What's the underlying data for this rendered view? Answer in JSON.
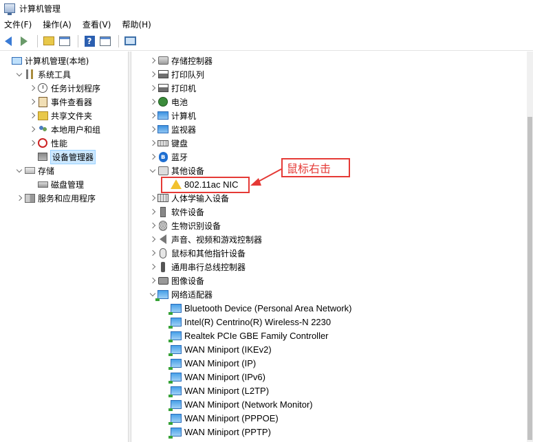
{
  "window": {
    "title": "计算机管理"
  },
  "menu": [
    "文件(F)",
    "操作(A)",
    "查看(V)",
    "帮助(H)"
  ],
  "toolbar": {
    "help_glyph": "?",
    "icons": [
      "back-icon",
      "forward-icon",
      "up-folder-icon",
      "show-hide-tree-icon",
      "help-icon",
      "properties-icon",
      "monitor-icon"
    ]
  },
  "left_tree": [
    {
      "label": "计算机管理(本地)",
      "icon": "computer-management-icon",
      "level": 0,
      "state": "none"
    },
    {
      "label": "系统工具",
      "icon": "system-tools-icon",
      "level": 1,
      "state": "expanded"
    },
    {
      "label": "任务计划程序",
      "icon": "task-scheduler-icon",
      "level": 2,
      "state": "collapsed"
    },
    {
      "label": "事件查看器",
      "icon": "event-viewer-icon",
      "level": 2,
      "state": "collapsed"
    },
    {
      "label": "共享文件夹",
      "icon": "shared-folders-icon",
      "level": 2,
      "state": "collapsed"
    },
    {
      "label": "本地用户和组",
      "icon": "local-users-icon",
      "level": 2,
      "state": "collapsed"
    },
    {
      "label": "性能",
      "icon": "performance-icon",
      "level": 2,
      "state": "collapsed"
    },
    {
      "label": "设备管理器",
      "icon": "device-manager-icon",
      "level": 2,
      "state": "none",
      "selected": true
    },
    {
      "label": "存储",
      "icon": "storage-icon",
      "level": 1,
      "state": "expanded"
    },
    {
      "label": "磁盘管理",
      "icon": "disk-management-icon",
      "level": 2,
      "state": "none"
    },
    {
      "label": "服务和应用程序",
      "icon": "services-apps-icon",
      "level": 1,
      "state": "collapsed"
    }
  ],
  "device_tree": [
    {
      "label": "存储控制器",
      "icon": "storage-controller-icon",
      "level": 0,
      "state": "collapsed"
    },
    {
      "label": "打印队列",
      "icon": "print-queue-icon",
      "level": 0,
      "state": "collapsed"
    },
    {
      "label": "打印机",
      "icon": "printer-icon",
      "level": 0,
      "state": "collapsed"
    },
    {
      "label": "电池",
      "icon": "battery-icon",
      "level": 0,
      "state": "collapsed"
    },
    {
      "label": "计算机",
      "icon": "computer-icon",
      "level": 0,
      "state": "collapsed"
    },
    {
      "label": "监视器",
      "icon": "monitor-icon",
      "level": 0,
      "state": "collapsed"
    },
    {
      "label": "键盘",
      "icon": "keyboard-icon",
      "level": 0,
      "state": "collapsed"
    },
    {
      "label": "蓝牙",
      "icon": "bluetooth-icon",
      "level": 0,
      "state": "collapsed"
    },
    {
      "label": "其他设备",
      "icon": "other-devices-icon",
      "level": 0,
      "state": "expanded"
    },
    {
      "label": "802.11ac NIC",
      "icon": "warning-device-icon",
      "level": 1,
      "state": "none"
    },
    {
      "label": "人体学输入设备",
      "icon": "hid-icon",
      "level": 0,
      "state": "collapsed"
    },
    {
      "label": "软件设备",
      "icon": "software-device-icon",
      "level": 0,
      "state": "collapsed"
    },
    {
      "label": "生物识别设备",
      "icon": "biometric-icon",
      "level": 0,
      "state": "collapsed"
    },
    {
      "label": "声音、视频和游戏控制器",
      "icon": "sound-icon",
      "level": 0,
      "state": "collapsed"
    },
    {
      "label": "鼠标和其他指针设备",
      "icon": "mouse-icon",
      "level": 0,
      "state": "collapsed"
    },
    {
      "label": "通用串行总线控制器",
      "icon": "usb-icon",
      "level": 0,
      "state": "collapsed"
    },
    {
      "label": "图像设备",
      "icon": "imaging-device-icon",
      "level": 0,
      "state": "collapsed"
    },
    {
      "label": "网络适配器",
      "icon": "network-adapter-icon",
      "level": 0,
      "state": "expanded"
    },
    {
      "label": "Bluetooth Device (Personal Area Network)",
      "icon": "network-adapter-icon",
      "level": 1,
      "state": "none"
    },
    {
      "label": "Intel(R) Centrino(R) Wireless-N 2230",
      "icon": "network-adapter-icon",
      "level": 1,
      "state": "none"
    },
    {
      "label": "Realtek PCIe GBE Family Controller",
      "icon": "network-adapter-icon",
      "level": 1,
      "state": "none"
    },
    {
      "label": "WAN Miniport (IKEv2)",
      "icon": "network-adapter-icon",
      "level": 1,
      "state": "none"
    },
    {
      "label": "WAN Miniport (IP)",
      "icon": "network-adapter-icon",
      "level": 1,
      "state": "none"
    },
    {
      "label": "WAN Miniport (IPv6)",
      "icon": "network-adapter-icon",
      "level": 1,
      "state": "none"
    },
    {
      "label": "WAN Miniport (L2TP)",
      "icon": "network-adapter-icon",
      "level": 1,
      "state": "none"
    },
    {
      "label": "WAN Miniport (Network Monitor)",
      "icon": "network-adapter-icon",
      "level": 1,
      "state": "none"
    },
    {
      "label": "WAN Miniport (PPPOE)",
      "icon": "network-adapter-icon",
      "level": 1,
      "state": "none"
    },
    {
      "label": "WAN Miniport (PPTP)",
      "icon": "network-adapter-icon",
      "level": 1,
      "state": "none"
    }
  ],
  "annotation": {
    "text": "鼠标右击",
    "color": "#e53935"
  },
  "colors": {
    "selection": "#cce8ff",
    "accent": "#1f6fd1"
  }
}
